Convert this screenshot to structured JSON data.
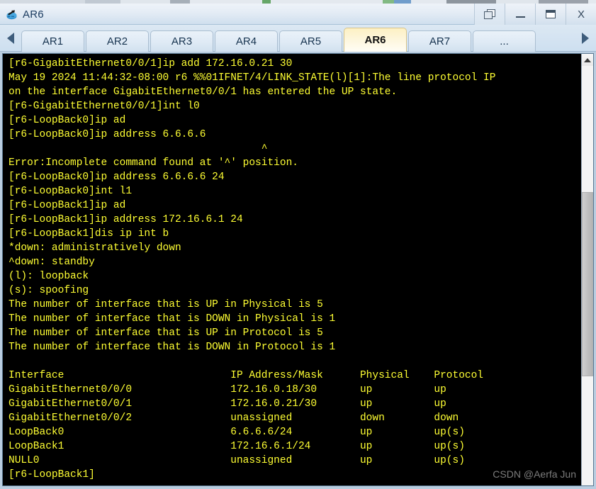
{
  "window": {
    "title": "AR6",
    "app_icon": "router-icon",
    "controls": [
      {
        "name": "restore-button",
        "label": "restore-icon"
      },
      {
        "name": "minimize-button",
        "label": "minimize-icon"
      },
      {
        "name": "maximize-button",
        "label": "maximize-icon"
      },
      {
        "name": "close-button",
        "label": "X"
      }
    ]
  },
  "tabbar": {
    "scroll_left": "◀",
    "scroll_right": "▶",
    "active_tab": "AR6",
    "tabs": [
      {
        "label": "AR1",
        "active": false
      },
      {
        "label": "AR2",
        "active": false
      },
      {
        "label": "AR3",
        "active": false
      },
      {
        "label": "AR4",
        "active": false
      },
      {
        "label": "AR5",
        "active": false
      },
      {
        "label": "AR6",
        "active": true
      },
      {
        "label": "AR7",
        "active": false
      },
      {
        "label": "...",
        "active": false
      }
    ]
  },
  "terminal": {
    "fg_color": "#ffff33",
    "bg_color": "#000000",
    "lines": [
      "[r6-GigabitEthernet0/0/1]ip add 172.16.0.21 30",
      "May 19 2024 11:44:32-08:00 r6 %%01IFNET/4/LINK_STATE(l)[1]:The line protocol IP",
      "on the interface GigabitEthernet0/0/1 has entered the UP state.",
      "[r6-GigabitEthernet0/0/1]int l0",
      "[r6-LoopBack0]ip ad",
      "[r6-LoopBack0]ip address 6.6.6.6",
      "                                         ^",
      "Error:Incomplete command found at '^' position.",
      "[r6-LoopBack0]ip address 6.6.6.6 24",
      "[r6-LoopBack0]int l1",
      "[r6-LoopBack1]ip ad",
      "[r6-LoopBack1]ip address 172.16.6.1 24",
      "[r6-LoopBack1]dis ip int b",
      "*down: administratively down",
      "^down: standby",
      "(l): loopback",
      "(s): spoofing",
      "The number of interface that is UP in Physical is 5",
      "The number of interface that is DOWN in Physical is 1",
      "The number of interface that is UP in Protocol is 5",
      "The number of interface that is DOWN in Protocol is 1",
      "",
      "Interface                           IP Address/Mask      Physical    Protocol",
      "GigabitEthernet0/0/0                172.16.0.18/30       up          up",
      "GigabitEthernet0/0/1                172.16.0.21/30       up          up",
      "GigabitEthernet0/0/2                unassigned           down        down",
      "LoopBack0                           6.6.6.6/24           up          up(s)",
      "LoopBack1                           172.16.6.1/24        up          up(s)",
      "NULL0                               unassigned           up          up(s)",
      "[r6-LoopBack1]"
    ],
    "interface_table": {
      "headers": [
        "Interface",
        "IP Address/Mask",
        "Physical",
        "Protocol"
      ],
      "rows": [
        [
          "GigabitEthernet0/0/0",
          "172.16.0.18/30",
          "up",
          "up"
        ],
        [
          "GigabitEthernet0/0/1",
          "172.16.0.21/30",
          "up",
          "up"
        ],
        [
          "GigabitEthernet0/0/2",
          "unassigned",
          "down",
          "down"
        ],
        [
          "LoopBack0",
          "6.6.6.6/24",
          "up",
          "up(s)"
        ],
        [
          "LoopBack1",
          "172.16.6.1/24",
          "up",
          "up(s)"
        ],
        [
          "NULL0",
          "unassigned",
          "up",
          "up(s)"
        ]
      ]
    },
    "prompt": "[r6-LoopBack1]"
  },
  "scrollbar": {
    "up_arrow": "▲"
  },
  "watermark": {
    "text": "CSDN @Aerfa Jun"
  }
}
